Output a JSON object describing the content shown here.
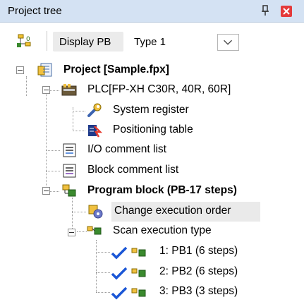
{
  "panel": {
    "title": "Project tree"
  },
  "toolbar": {
    "display_button": "Display PB",
    "type_value": "Type 1"
  },
  "tree": {
    "project": "Project [Sample.fpx]",
    "plc": "PLC[FP-XH C30R, 40R, 60R]",
    "system_register": "System register",
    "positioning_table": "Positioning table",
    "io_comment": "I/O comment list",
    "block_comment": "Block comment list",
    "program_block": "Program block (PB-17 steps)",
    "change_order": "Change execution order",
    "scan_type": "Scan execution type",
    "pb1": "1: PB1 (6 steps)",
    "pb2": "2: PB2 (6 steps)",
    "pb3": "3: PB3 (3 steps)"
  },
  "icons": {
    "pin": "pin-icon",
    "close": "close-icon",
    "network": "network-icon",
    "project": "project-icon",
    "plc": "plc-icon",
    "wrench": "wrench-icon",
    "table": "positioning-table-icon",
    "list": "list-icon",
    "program": "program-block-icon",
    "gear": "gear-icon",
    "check": "checkmark-icon"
  },
  "colors": {
    "title_bar": "#d4e2f3",
    "close": "#e43b3b",
    "check": "#1a56d6",
    "selected_bg": "#eaeaea"
  }
}
